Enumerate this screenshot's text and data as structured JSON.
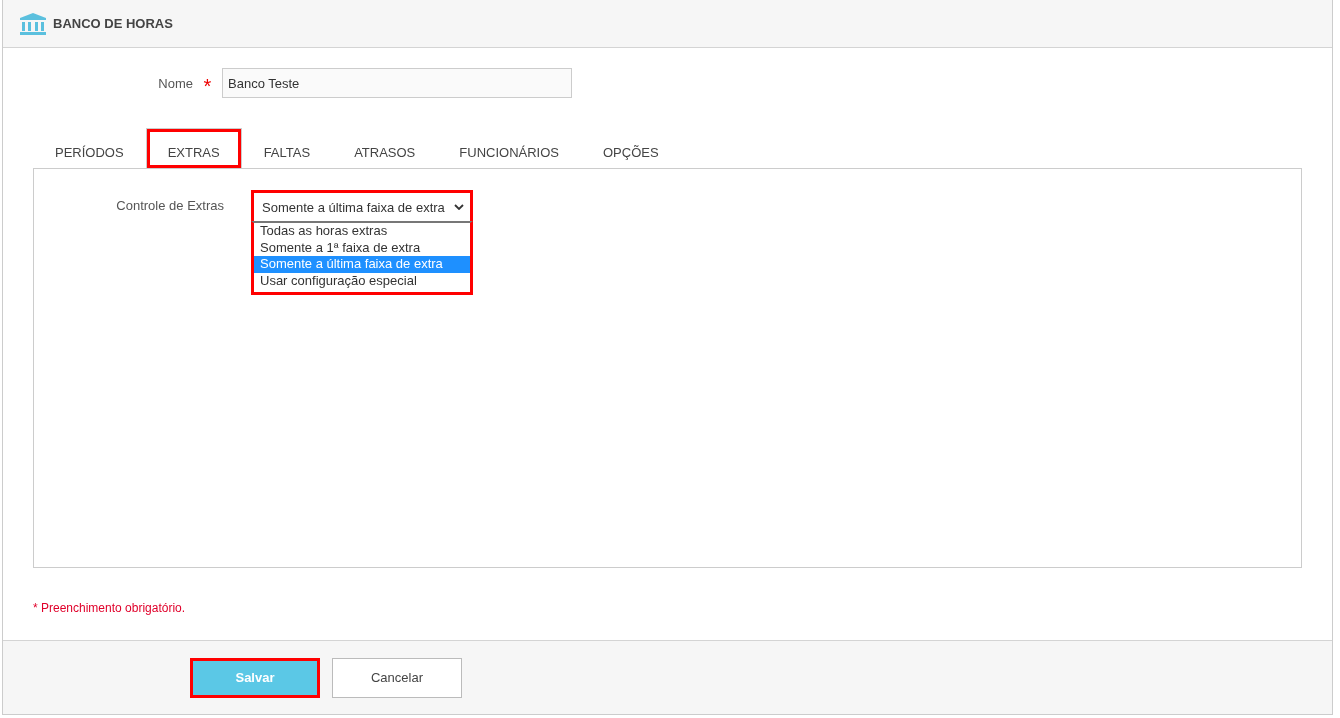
{
  "header": {
    "title": "BANCO DE HORAS"
  },
  "name_field": {
    "label": "Nome",
    "required_mark": "*",
    "value": "Banco Teste"
  },
  "tabs": [
    {
      "label": "PERÍODOS",
      "selected": false,
      "highlighted": false
    },
    {
      "label": "EXTRAS",
      "selected": true,
      "highlighted": true
    },
    {
      "label": "FALTAS",
      "selected": false,
      "highlighted": false
    },
    {
      "label": "ATRASOS",
      "selected": false,
      "highlighted": false
    },
    {
      "label": "FUNCIONÁRIOS",
      "selected": false,
      "highlighted": false
    },
    {
      "label": "OPÇÕES",
      "selected": false,
      "highlighted": false
    }
  ],
  "extras_control": {
    "label": "Controle de Extras",
    "value": "Somente a última faixa de extra",
    "expanded": true,
    "highlighted": true,
    "options": [
      {
        "label": "Todas as horas extras",
        "selected": false
      },
      {
        "label": "Somente a 1ª faixa de extra",
        "selected": false
      },
      {
        "label": "Somente a última faixa de extra",
        "selected": true
      },
      {
        "label": "Usar configuração especial",
        "selected": false
      }
    ]
  },
  "required_note": "* Preenchimento obrigatório.",
  "buttons": [
    {
      "label": "Salvar",
      "kind": "primary",
      "highlighted": true
    },
    {
      "label": "Cancelar",
      "kind": "secondary",
      "highlighted": false
    }
  ]
}
